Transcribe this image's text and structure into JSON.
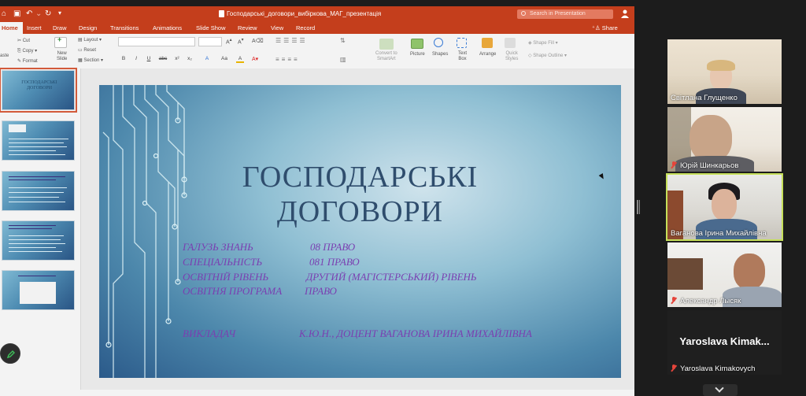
{
  "titlebar": {
    "document_title": "Господарські_договори_вибіркова_МАГ_презентація",
    "search_placeholder": "Search in Presentation"
  },
  "tabs": [
    "Home",
    "Insert",
    "Draw",
    "Design",
    "Transitions",
    "Animations",
    "Slide Show",
    "Review",
    "View",
    "Record"
  ],
  "share_label": "Share",
  "ribbon": {
    "cut": "Cut",
    "copy": "Copy",
    "format": "Format",
    "paste": "aste",
    "new_slide": [
      "New",
      "Slide"
    ],
    "layout": "Layout",
    "reset": "Reset",
    "section": "Section",
    "convert_smartart": [
      "Convert to",
      "SmartArt"
    ],
    "picture": "Picture",
    "shapes": "Shapes",
    "text_box": [
      "Text",
      "Box"
    ],
    "arrange": "Arrange",
    "quick_styles": [
      "Quick",
      "Styles"
    ],
    "shape_fill": "Shape Fill",
    "shape_outline": "Shape Outline",
    "format_buttons": [
      "B",
      "I",
      "U",
      "abc",
      "x²",
      "x₂",
      "A",
      "Aa",
      "A"
    ]
  },
  "thumbnails": {
    "slide1_title": [
      "ГОСПОДАРСЬКІ",
      "ДОГОВОРИ"
    ]
  },
  "slide": {
    "title_line1": "ГОСПОДАРСЬКІ",
    "title_line2": "ДОГОВОРИ",
    "rows": [
      {
        "label": "Галузь знань",
        "value": "08 Право"
      },
      {
        "label": "Спеціальність",
        "value": "081 Право"
      },
      {
        "label": "Освітній рівень",
        "value": "другий (магістерський) рівень"
      },
      {
        "label": "Освітня програма",
        "value": "Право"
      }
    ],
    "teacher_label": "Викладач",
    "teacher_value": "к.ю.н., доцент Ваганова Ірина Михайлівна"
  },
  "participants": [
    {
      "name": "Світлана Глущенко",
      "muted": false
    },
    {
      "name": "Юрій Шинкарьов",
      "muted": true
    },
    {
      "name": "Ваганова Ірина Михайлівна",
      "muted": false,
      "speaking": true
    },
    {
      "name": "Александр Лысяк",
      "muted": true
    },
    {
      "name": "Yaroslava Kimakovych",
      "muted": true,
      "display": "Yaroslava  Kimak..."
    }
  ],
  "colors": {
    "accent": "#c43e1c",
    "speaking_border": "#c6e05a",
    "slide_text": "#7a3fb1",
    "slide_title": "#2f4d6d"
  }
}
